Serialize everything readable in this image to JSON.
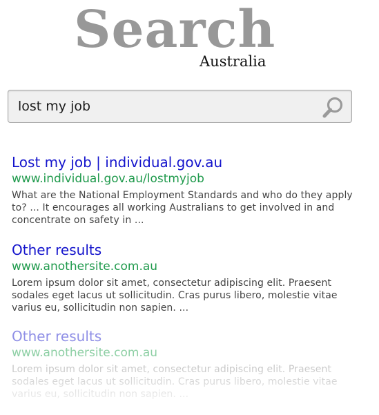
{
  "logo": {
    "main_text": "Search",
    "sub_text": "Australia"
  },
  "search": {
    "query": "lost my job",
    "button_icon": "search-icon"
  },
  "results": [
    {
      "title": "Lost my job | individual.gov.au",
      "url": "www.individual.gov.au/lostmyjob",
      "snippet": "What are the National Employment Standards and who do they apply to? ... It encourages all working Australians to get involved in and concentrate on safety in ..."
    },
    {
      "title": "Other results",
      "url": "www.anothersite.com.au",
      "snippet": "Lorem ipsum dolor sit amet, consectetur adipiscing elit. Praesent sodales eget lacus ut sollicitudin. Cras purus libero, molestie vitae varius eu, sollicitudin non sapien. ..."
    },
    {
      "title": "Other results",
      "url": "www.anothersite.com.au",
      "snippet": "Lorem ipsum dolor sit amet, consectetur adipiscing elit. Praesent sodales eget lacus ut sollicitudin. Cras purus libero, molestie vitae varius eu, sollicitudin non sapien. ..."
    }
  ],
  "colors": {
    "title_link": "#1414cc",
    "url_green": "#1f9a4c",
    "logo_gray": "#989898"
  }
}
